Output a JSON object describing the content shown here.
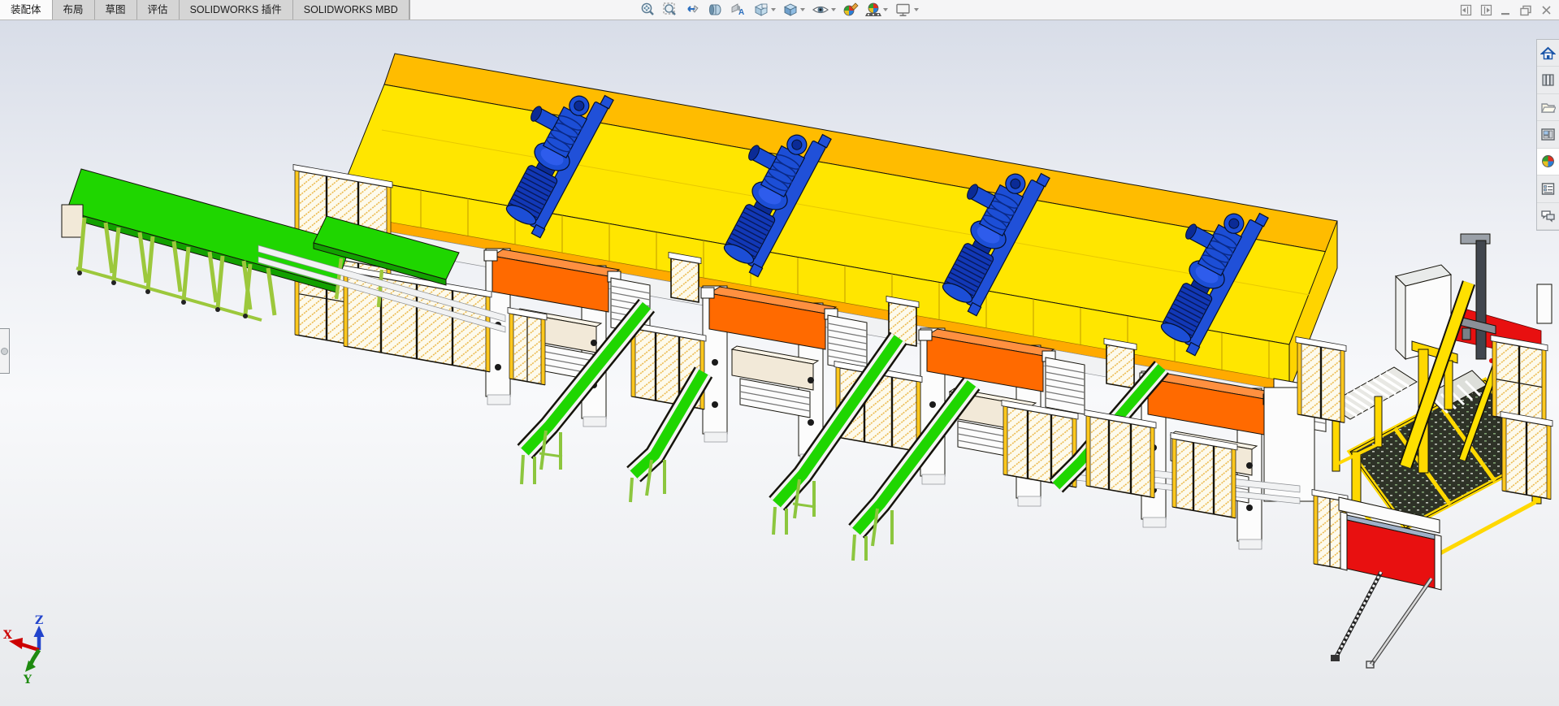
{
  "ribbon": {
    "tabs": [
      {
        "label": "装配体",
        "active": true
      },
      {
        "label": "布局",
        "active": false
      },
      {
        "label": "草图",
        "active": false
      },
      {
        "label": "评估",
        "active": false
      },
      {
        "label": "SOLIDWORKS 插件",
        "active": false
      },
      {
        "label": "SOLIDWORKS MBD",
        "active": false
      }
    ]
  },
  "toolbar": {
    "buttons": [
      {
        "name": "zoom-to-fit"
      },
      {
        "name": "zoom-to-area"
      },
      {
        "name": "previous-view"
      },
      {
        "name": "section-view"
      },
      {
        "name": "annotation-views"
      },
      {
        "name": "view-orientation",
        "has_dropdown": true
      },
      {
        "name": "display-style",
        "has_dropdown": true
      },
      {
        "name": "hide-show-items",
        "has_dropdown": true
      },
      {
        "name": "edit-appearance",
        "has_dropdown": false
      },
      {
        "name": "apply-scene",
        "has_dropdown": true
      },
      {
        "name": "view-settings",
        "has_dropdown": true
      }
    ]
  },
  "window_controls": {
    "buttons": [
      {
        "name": "toggle-left-pane"
      },
      {
        "name": "toggle-right-pane"
      },
      {
        "name": "minimize"
      },
      {
        "name": "restore"
      },
      {
        "name": "close"
      }
    ]
  },
  "task_pane": {
    "items": [
      {
        "name": "solidworks-resources",
        "icon": "home"
      },
      {
        "name": "design-library",
        "icon": "books"
      },
      {
        "name": "file-explorer",
        "icon": "folder"
      },
      {
        "name": "view-palette",
        "icon": "window"
      },
      {
        "name": "appearances-scenes",
        "icon": "color-sphere",
        "selected": true
      },
      {
        "name": "custom-properties",
        "icon": "form"
      },
      {
        "name": "solidworks-forum",
        "icon": "chat"
      }
    ]
  },
  "viewport": {
    "triad": {
      "x": "X",
      "y": "Y",
      "z": "Z"
    },
    "colors": {
      "platform_yellow": "#FFE600",
      "platform_amber": "#FFBC00",
      "belt_green": "#1FD600",
      "leg_green": "#9CC83C",
      "pump_blue": "#1C4ED6",
      "beam_orange": "#FF6A00",
      "door_red": "#E81010",
      "cream": "#F2E9D8",
      "fence_hatch": "#E9B23C",
      "machine_yellow": "#FFD800"
    },
    "model_parts": [
      {
        "label": "infeed belt conveyor",
        "color": "#1FD600"
      },
      {
        "label": "press line platform",
        "color": "#FFE600"
      },
      {
        "label": "multistage pumps x4",
        "color": "#1C4ED6"
      },
      {
        "label": "press slides x4",
        "color": "#FF6A00"
      },
      {
        "label": "incline discharge conveyors",
        "color": "#1FD600"
      },
      {
        "label": "safety fencing",
        "color": "#E9B23C"
      },
      {
        "label": "stacking machine",
        "color": "#FFD800"
      },
      {
        "label": "roll-up door",
        "color": "#E81010"
      }
    ]
  }
}
